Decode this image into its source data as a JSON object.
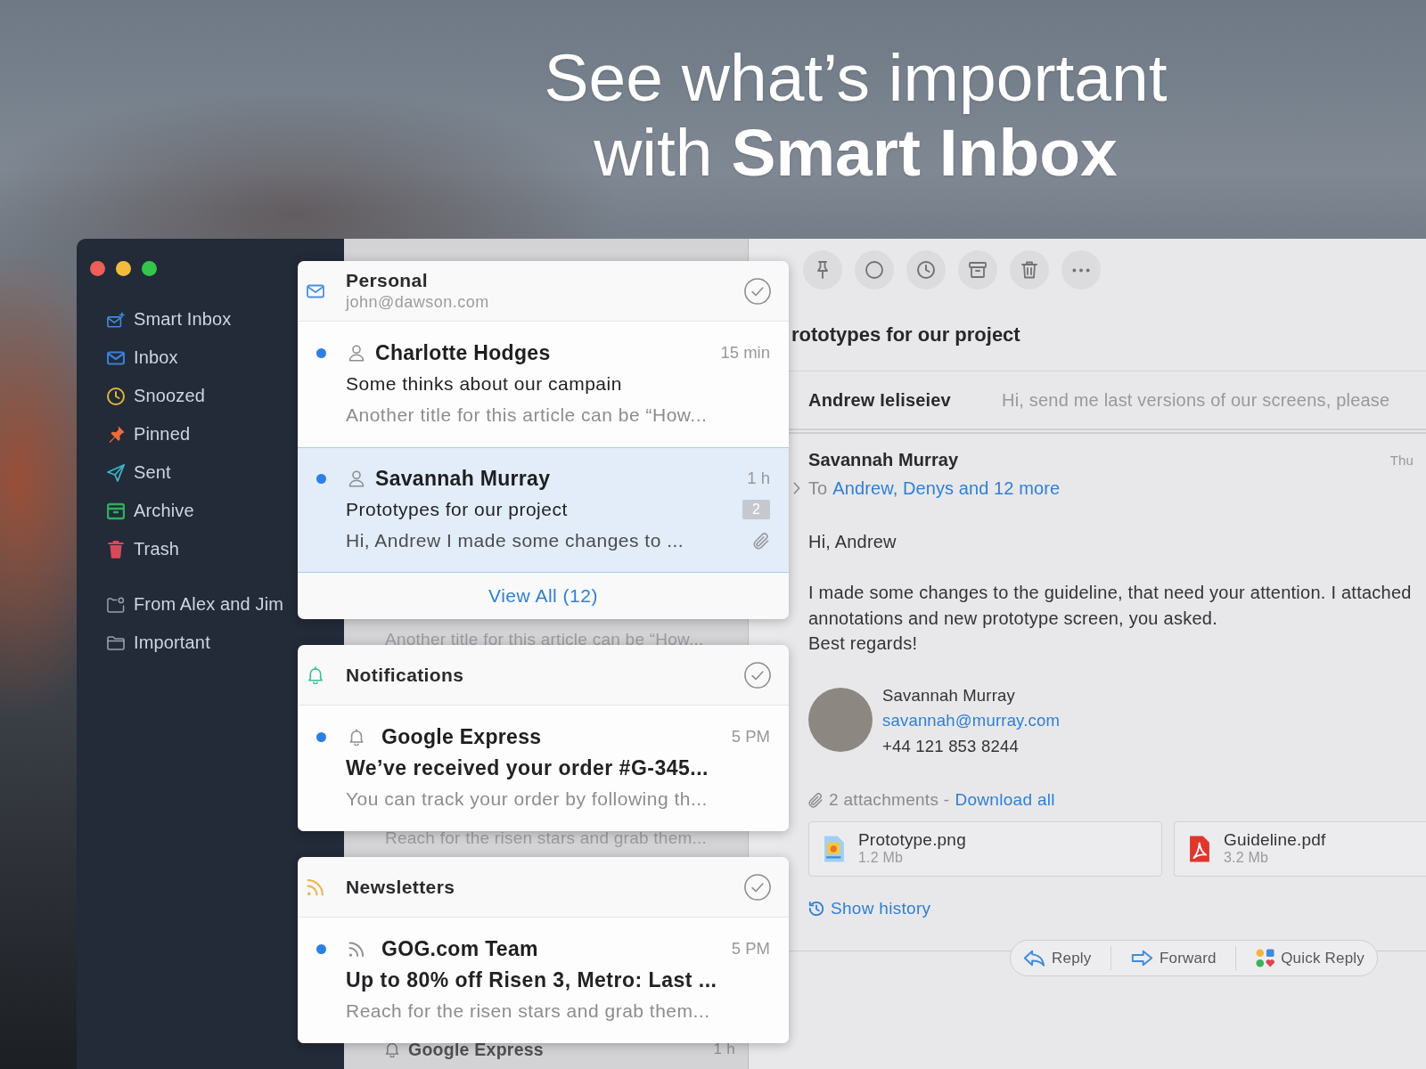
{
  "headline": {
    "lines": [
      "See what’s important",
      "with **Smart Inbox**"
    ]
  },
  "sidebar": {
    "mailboxes": [
      {
        "label": "Smart Inbox",
        "color": "#3f8ae0"
      },
      {
        "label": "Inbox",
        "color": "#3a7fd5"
      },
      {
        "label": "Snoozed",
        "color": "#e2b537"
      },
      {
        "label": "Pinned",
        "color": "#f06a3a"
      },
      {
        "label": "Sent",
        "color": "#3ab7c8"
      },
      {
        "label": "Archive",
        "color": "#2fae5e"
      },
      {
        "label": "Trash",
        "color": "#d84a5a"
      }
    ],
    "folders": [
      {
        "label": "From Alex and Jim"
      },
      {
        "label": "Important"
      }
    ]
  },
  "list_behind": [
    {
      "kind": "preview",
      "text": "Another title for this article can be “How..."
    },
    {
      "kind": "preview",
      "text": "Reach for the risen stars and grab them..."
    },
    {
      "kind": "sender",
      "text": "Google Express",
      "time": "1 h"
    }
  ],
  "sections": [
    {
      "kind": "account",
      "title": "Personal",
      "subtitle": "john@dawson.com",
      "color": "#4a90e2",
      "messages": [
        {
          "sender": "Charlotte Hodges",
          "time": "15 min",
          "subject": "Some thinks about our campain",
          "preview": "Another title for this article can be “How...",
          "unread": true,
          "selected": false,
          "attachment": false
        },
        {
          "sender": "Savannah Murray",
          "time": "1 h",
          "subject": "Prototypes for our project",
          "count": "2",
          "preview": "Hi, Andrew I made some changes to ...",
          "unread": true,
          "selected": true,
          "attachment": true
        }
      ],
      "footer": "View All (12)"
    },
    {
      "kind": "notifications",
      "title": "Notifications",
      "color": "#3cbf9c",
      "messages": [
        {
          "sender": "Google Express",
          "time": "5 PM",
          "subject": "We’ve received your order #G-345...",
          "preview": "You can track your order by following th...",
          "unread": true,
          "selected": false,
          "attachment": false
        }
      ]
    },
    {
      "kind": "newsletters",
      "title": "Newsletters",
      "color": "#f0b45a",
      "messages": [
        {
          "sender": "GOG.com Team",
          "time": "5 PM",
          "subject": "Up to 80% off Risen 3, Metro: Last ...",
          "preview": "Reach for the risen stars and grab them...",
          "unread": true,
          "selected": false,
          "attachment": false
        }
      ]
    }
  ],
  "message": {
    "subject": "rototypes for our project",
    "thread": [
      {
        "sender": "Andrew Ieliseiev",
        "preview": "Hi, send me last versions of our screens, please"
      }
    ],
    "sender": "Savannah Murray",
    "date": "Thu",
    "to_label": "To",
    "recipients": "Andrew, Denys and 12 more",
    "greeting": "Hi, Andrew",
    "body_lines": [
      "I made some changes to the guideline, that need your attention. I attached",
      "annotations and new prototype screen, you asked.",
      "Best regards!"
    ],
    "signature": {
      "name": "Savannah Murray",
      "email": "savannah@murray.com",
      "phone": "+44 121 853 8244"
    },
    "attachment_summary": "2 attachments -",
    "download_all": "Download all",
    "attachments": [
      {
        "kind": "image",
        "name": "Prototype.png",
        "size": "1.2 Mb"
      },
      {
        "kind": "pdf",
        "name": "Guideline.pdf",
        "size": "3.2 Mb"
      }
    ],
    "show_history": "Show history"
  },
  "reply_bar": [
    {
      "kind": "reply",
      "label": "Reply"
    },
    {
      "kind": "forward",
      "label": "Forward"
    },
    {
      "kind": "quick_reply",
      "label": "Quick Reply"
    }
  ]
}
